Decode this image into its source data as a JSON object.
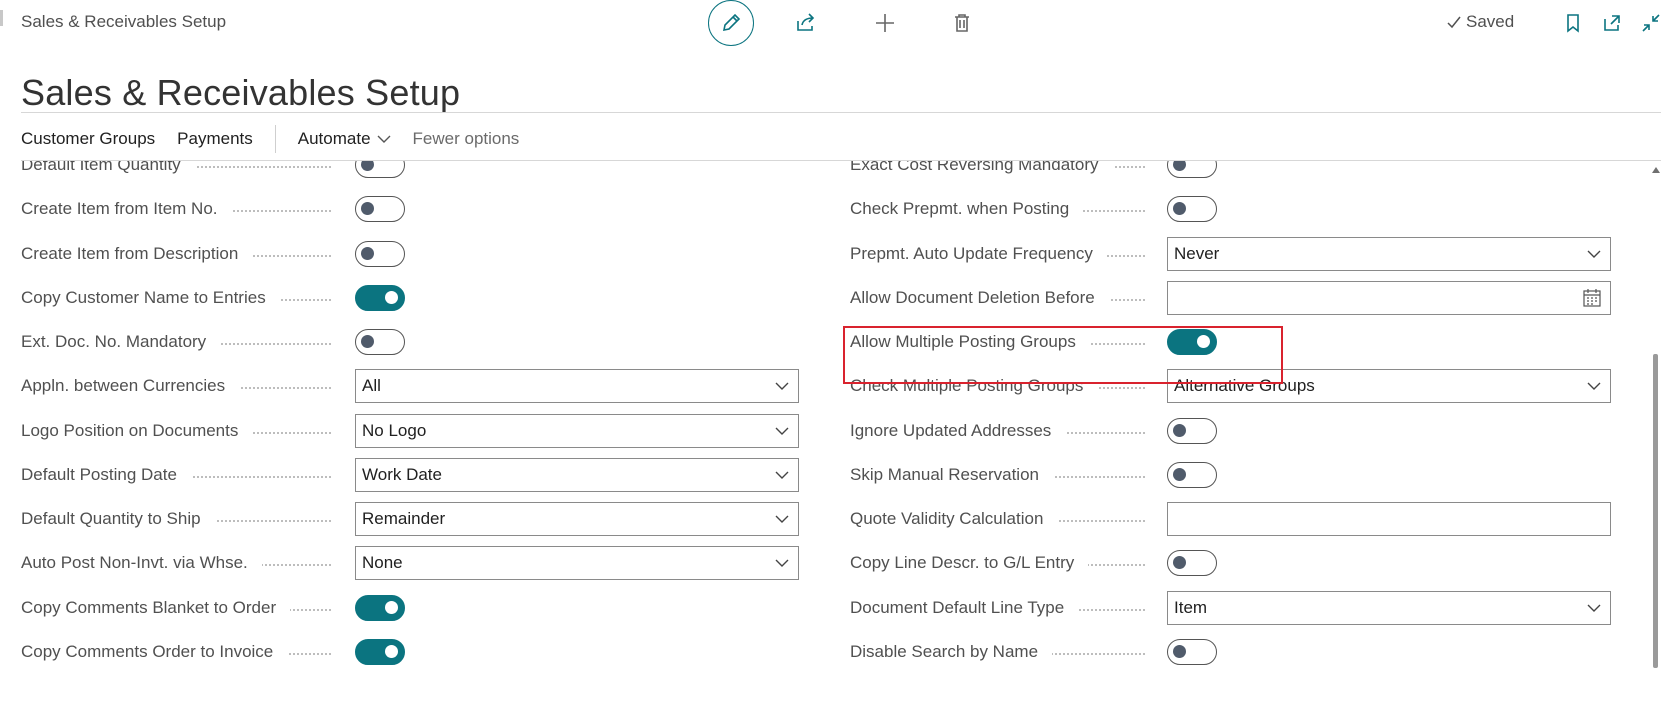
{
  "header": {
    "breadcrumb_title": "Sales & Receivables Setup",
    "saved_label": "Saved"
  },
  "page_title": "Sales & Receivables Setup",
  "actions": {
    "customer_groups": "Customer Groups",
    "payments": "Payments",
    "automate": "Automate",
    "fewer_options": "Fewer options"
  },
  "left_fields": [
    {
      "label": "Default Item Quantity",
      "type": "toggle",
      "value": "off"
    },
    {
      "label": "Create Item from Item No.",
      "type": "toggle",
      "value": "off"
    },
    {
      "label": "Create Item from Description",
      "type": "toggle",
      "value": "off"
    },
    {
      "label": "Copy Customer Name to Entries",
      "type": "toggle",
      "value": "on"
    },
    {
      "label": "Ext. Doc. No. Mandatory",
      "type": "toggle",
      "value": "off"
    },
    {
      "label": "Appln. between Currencies",
      "type": "select",
      "value": "All"
    },
    {
      "label": "Logo Position on Documents",
      "type": "select",
      "value": "No Logo"
    },
    {
      "label": "Default Posting Date",
      "type": "select",
      "value": "Work Date"
    },
    {
      "label": "Default Quantity to Ship",
      "type": "select",
      "value": "Remainder"
    },
    {
      "label": "Auto Post Non-Invt. via Whse.",
      "type": "select",
      "value": "None"
    },
    {
      "label": "Copy Comments Blanket to Order",
      "type": "toggle",
      "value": "on"
    },
    {
      "label": "Copy Comments Order to Invoice",
      "type": "toggle",
      "value": "on"
    }
  ],
  "right_fields": [
    {
      "label": "Exact Cost Reversing Mandatory",
      "type": "toggle",
      "value": "off"
    },
    {
      "label": "Check Prepmt. when Posting",
      "type": "toggle",
      "value": "off"
    },
    {
      "label": "Prepmt. Auto Update Frequency",
      "type": "select",
      "value": "Never"
    },
    {
      "label": "Allow Document Deletion Before",
      "type": "date",
      "value": ""
    },
    {
      "label": "Allow Multiple Posting Groups",
      "type": "toggle",
      "value": "on"
    },
    {
      "label": "Check Multiple Posting Groups",
      "type": "select",
      "value": "Alternative Groups"
    },
    {
      "label": "Ignore Updated Addresses",
      "type": "toggle",
      "value": "off"
    },
    {
      "label": "Skip Manual Reservation",
      "type": "toggle",
      "value": "off"
    },
    {
      "label": "Quote Validity Calculation",
      "type": "text",
      "value": ""
    },
    {
      "label": "Copy Line Descr. to G/L Entry",
      "type": "toggle",
      "value": "off"
    },
    {
      "label": "Document Default Line Type",
      "type": "select",
      "value": "Item"
    },
    {
      "label": "Disable Search by Name",
      "type": "toggle",
      "value": "off"
    }
  ],
  "colors": {
    "accent": "#0b7480",
    "highlight": "#d9232e"
  }
}
